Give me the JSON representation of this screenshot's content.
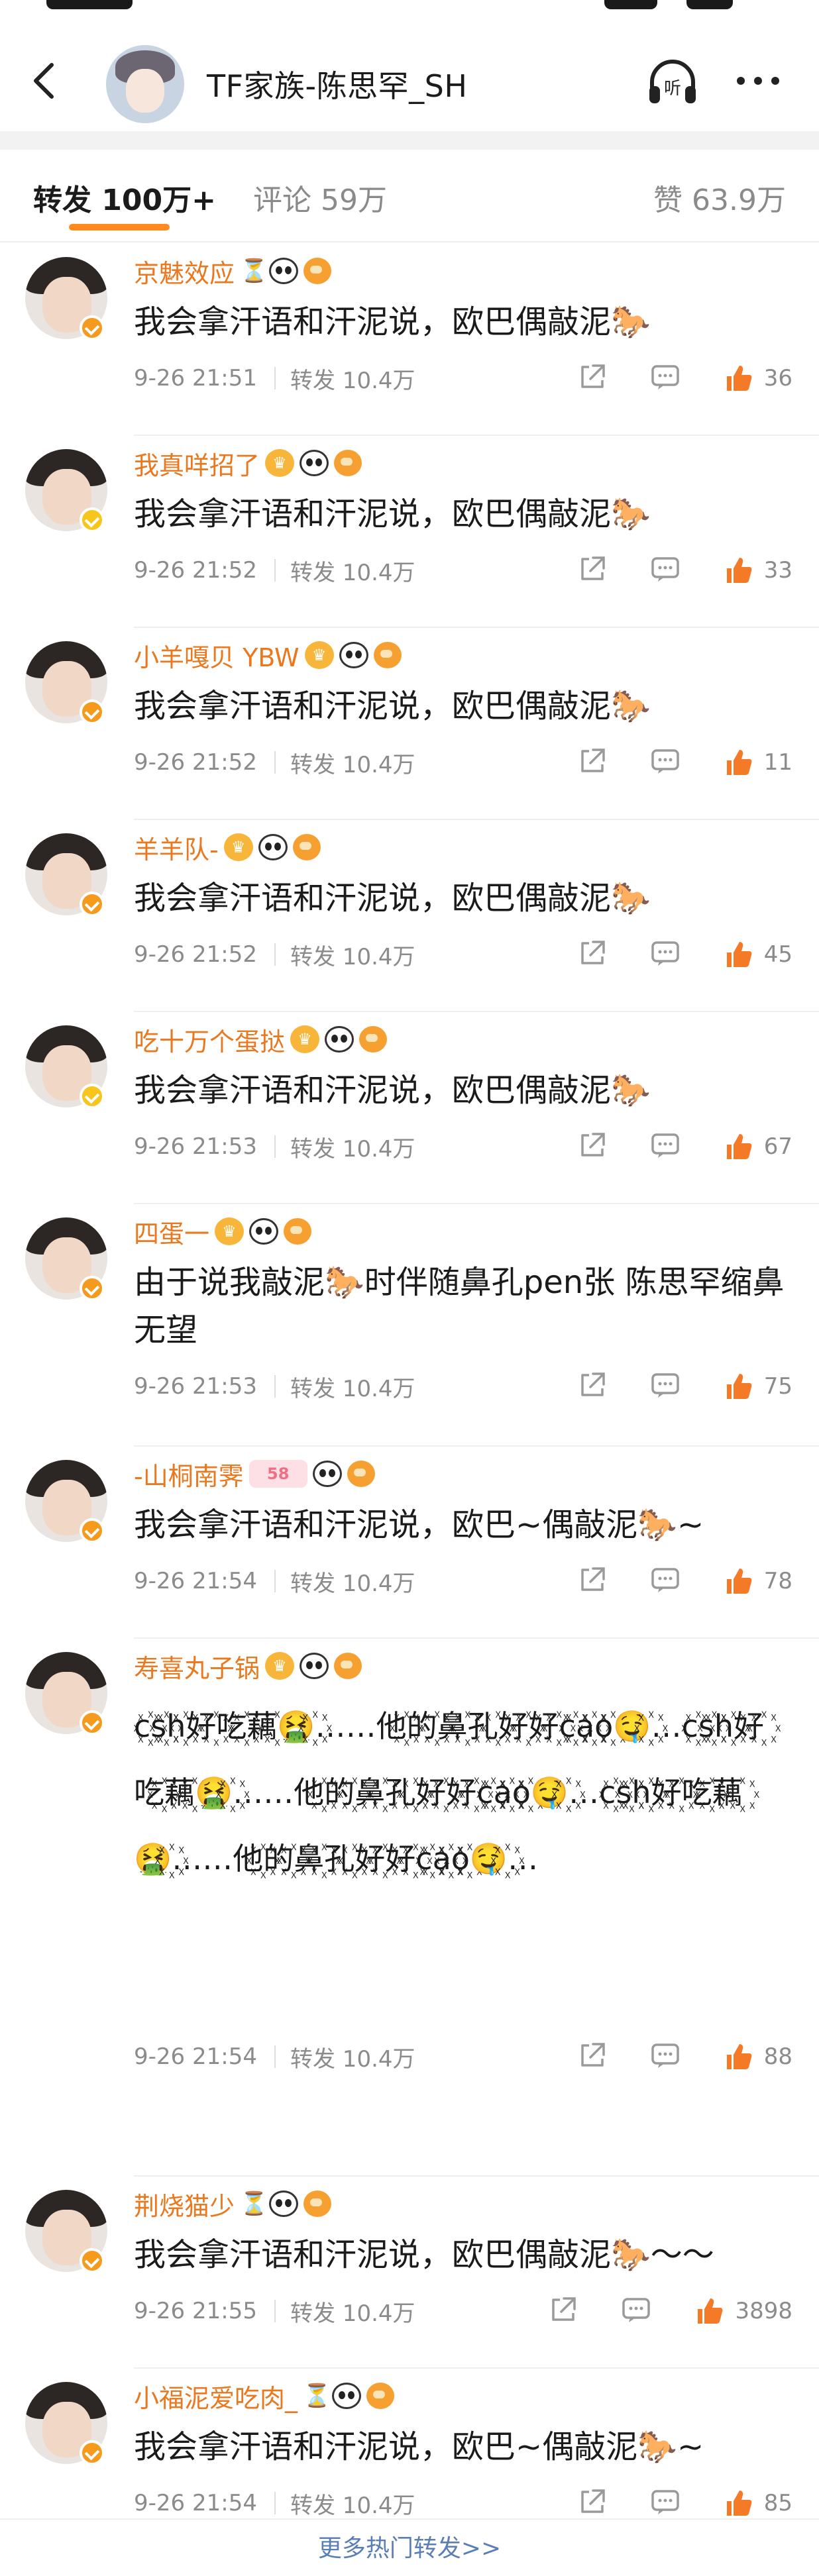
{
  "header": {
    "title": "TF家族-陈思罕_SH",
    "listen_label": "听"
  },
  "tabs": {
    "repost": "转发 100万+",
    "comment": "评论 59万",
    "like": "赞 63.9万"
  },
  "icons": {
    "back": "chevron-left-icon",
    "listen": "headphones-icon",
    "more": "more-dots-icon",
    "share": "share-icon",
    "comment": "comment-icon",
    "like": "thumbs-up-icon"
  },
  "colors": {
    "username": "#e9781f",
    "accent": "#ff8a1f",
    "like": "#f47a27",
    "link": "#5a7fb5"
  },
  "items": [
    {
      "username": "京魅效应",
      "badges": [
        "hourglass",
        "panda",
        "orange"
      ],
      "verified": "orange",
      "content": "我会拿汗语和汗泥说，欧巴偶敲泥🐎",
      "time": "9-26 21:51",
      "reposts": "转发 10.4万",
      "likes": "36"
    },
    {
      "username": "我真咩招了",
      "badges": [
        "crown",
        "panda",
        "orange"
      ],
      "verified": "yellow",
      "content": "我会拿汗语和汗泥说，欧巴偶敲泥🐎",
      "time": "9-26 21:52",
      "reposts": "转发 10.4万",
      "likes": "33"
    },
    {
      "username": "小羊嘎贝 YBW",
      "badges": [
        "crown",
        "panda",
        "orange"
      ],
      "verified": "orange",
      "content": "我会拿汗语和汗泥说，欧巴偶敲泥🐎",
      "time": "9-26 21:52",
      "reposts": "转发 10.4万",
      "likes": "11"
    },
    {
      "username": "羊羊队-",
      "badges": [
        "crown",
        "panda",
        "orange"
      ],
      "verified": "orange",
      "content": "我会拿汗语和汗泥说，欧巴偶敲泥🐎",
      "time": "9-26 21:52",
      "reposts": "转发 10.4万",
      "likes": "45"
    },
    {
      "username": "吃十万个蛋挞",
      "badges": [
        "crown",
        "panda",
        "orange"
      ],
      "verified": "yellow",
      "content": "我会拿汗语和汗泥说，欧巴偶敲泥🐎",
      "time": "9-26 21:53",
      "reposts": "转发 10.4万",
      "likes": "67"
    },
    {
      "username": "四蛋一",
      "badges": [
        "crown",
        "panda",
        "orange"
      ],
      "verified": "orange",
      "content": "由于说我敲泥🐎时伴随鼻孔pen张 陈思罕缩鼻无望",
      "time": "9-26 21:53",
      "reposts": "转发 10.4万",
      "likes": "75"
    },
    {
      "username": "-山桐南霁",
      "badges": [
        "vip",
        "panda",
        "orange"
      ],
      "vip_label": "58",
      "verified": "orange",
      "content": "我会拿汗语和汗泥说，欧巴~偶敲泥🐎~",
      "time": "9-26 21:54",
      "reposts": "转发 10.4万",
      "likes": "78"
    },
    {
      "username": "寿喜丸子锅",
      "badges": [
        "crown",
        "panda",
        "orange"
      ],
      "verified": "orange",
      "content": "c꙰s꙰h꙰好꙰吃꙰藕꙰🤮꙰……他꙰的꙰鼻꙰孔꙰好꙰好꙰c꙰a꙰o꙰🤤꙰…c꙰s꙰h꙰好꙰吃꙰藕꙰🤮꙰……他꙰的꙰鼻꙰孔꙰好꙰好꙰c꙰a꙰o꙰🤤꙰…c꙰s꙰h꙰好꙰吃꙰藕꙰🤮꙰……他꙰的꙰鼻꙰孔꙰好꙰好꙰c꙰a꙰o꙰🤤꙰…",
      "time": "9-26 21:54",
      "reposts": "转发 10.4万",
      "likes": "88"
    },
    {
      "username": "荆烧猫少",
      "badges": [
        "hourglass",
        "panda",
        "orange"
      ],
      "verified": "orange",
      "content": "我会拿汗语和汗泥说，欧巴偶敲泥🐎～～",
      "time": "9-26 21:55",
      "reposts": "转发 10.4万",
      "likes": "3898"
    },
    {
      "username": "小福泥爱吃肉_",
      "badges": [
        "hourglass",
        "panda",
        "orange"
      ],
      "verified": "orange",
      "content": "我会拿汗语和汗泥说，欧巴~偶敲泥🐎~",
      "time": "9-26 21:54",
      "reposts": "转发 10.4万",
      "likes": "85"
    }
  ],
  "footer": {
    "more_link": "更多热门转发>>"
  }
}
